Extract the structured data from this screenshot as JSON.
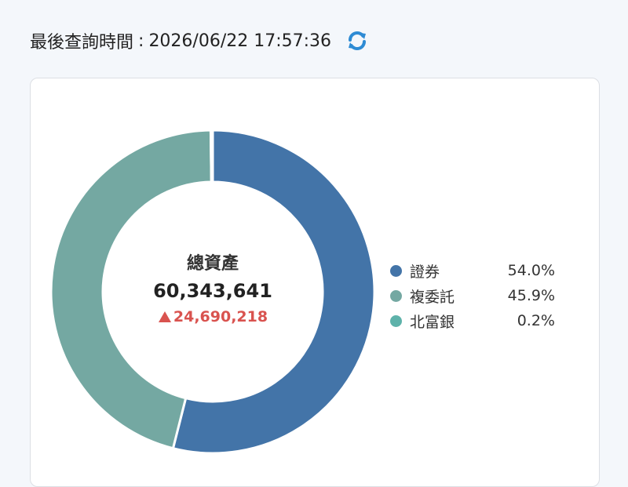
{
  "header": {
    "label": "最後查詢時間",
    "separator": ":",
    "timestamp": "2026/06/22 17:57:36",
    "refresh_icon": "refresh-icon",
    "refresh_color": "#2e8bd4"
  },
  "summary": {
    "label": "總資產",
    "total": "60,343,641",
    "change": "24,690,218",
    "change_icon": "triangle-up-icon",
    "change_color": "#d9534f"
  },
  "chart_data": {
    "type": "pie",
    "donut": true,
    "categories": [
      "證券",
      "複委託",
      "北富銀"
    ],
    "values": [
      54.0,
      45.9,
      0.2
    ],
    "labels": [
      "54.0%",
      "45.9%",
      "0.2%"
    ],
    "colors": [
      "#4374a8",
      "#74a8a2",
      "#5eb2aa"
    ],
    "legend_position": "right"
  }
}
